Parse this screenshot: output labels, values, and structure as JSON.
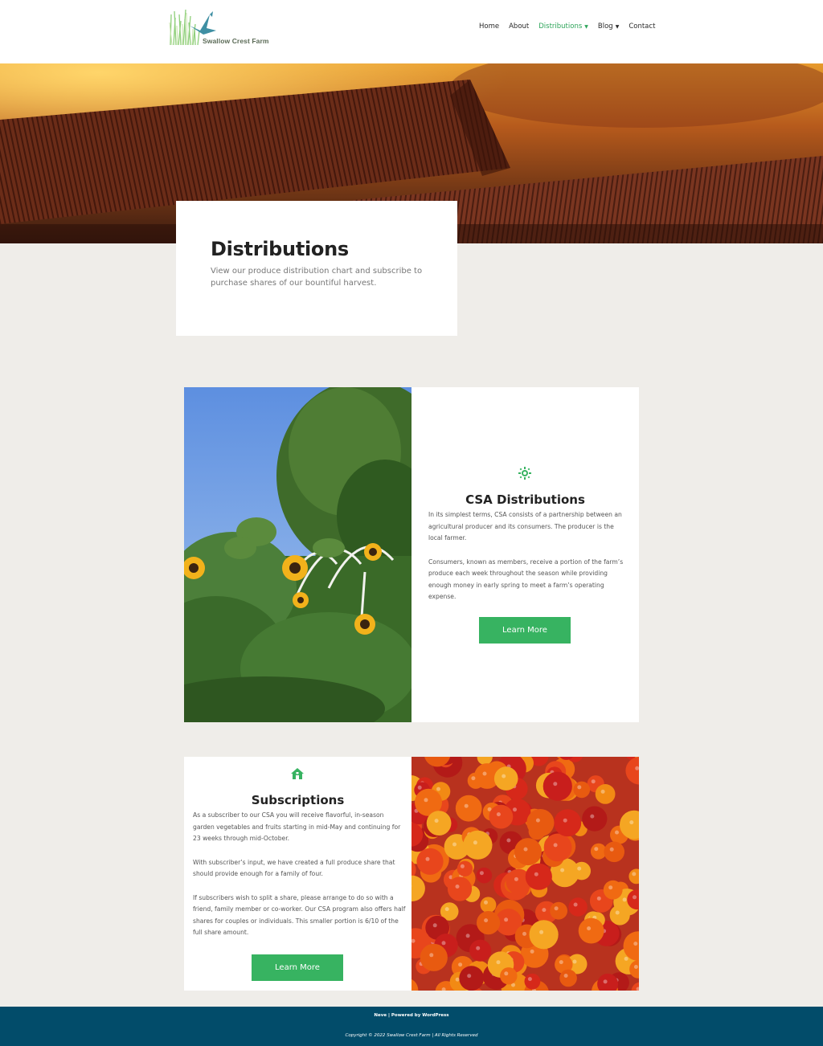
{
  "site": {
    "logo_text": "Swallow Crest Farm"
  },
  "nav": {
    "items": [
      {
        "label": "Home",
        "active": false,
        "dropdown": false
      },
      {
        "label": "About",
        "active": false,
        "dropdown": false
      },
      {
        "label": "Distributions",
        "active": true,
        "dropdown": true
      },
      {
        "label": "Blog",
        "active": false,
        "dropdown": true
      },
      {
        "label": "Contact",
        "active": false,
        "dropdown": false
      }
    ]
  },
  "page": {
    "title": "Distributions",
    "subtitle": "View our produce distribution chart and subscribe to purchase shares of our bountiful harvest."
  },
  "csa": {
    "icon": "sun-icon",
    "title": "CSA Distributions",
    "paragraphs": [
      "In its simplest terms, CSA consists of a partnership between an agricultural producer and its consumers. The producer is the local farmer.",
      "Consumers, known as members, receive a portion of the farm’s produce each week throughout the season while providing enough money in early spring to meet a farm’s operating expense."
    ],
    "button": "Learn More"
  },
  "subscriptions": {
    "icon": "home-icon",
    "title": "Subscriptions",
    "paragraphs": [
      "As a subscriber to our CSA you will receive flavorful, in-season garden vegetables and fruits starting in mid-May and continuing for 23 weeks through mid-October.",
      "With subscriber’s input, we have created a full produce share that should provide enough for a family of four.",
      "If subscribers wish to split a share, please arrange to do so with a friend, family member or co-worker. Our CSA program also offers half shares for couples or individuals. This smaller portion is 6/10 of the full share amount."
    ],
    "button": "Learn More"
  },
  "footer": {
    "credit": "Neve | Powered by WordPress",
    "copyright": "Copyright © 2022 Swallow Crest Farm | All Rights Reserved"
  },
  "colors": {
    "accent": "#37b361",
    "footer": "#024c6a",
    "page_bg": "#efede9"
  }
}
